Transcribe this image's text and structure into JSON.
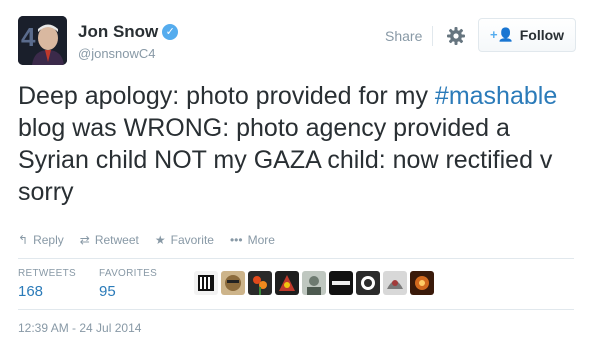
{
  "header": {
    "name": "Jon Snow",
    "username": "@jonsnowC4",
    "share_label": "Share",
    "follow_label": "Follow"
  },
  "tweet": {
    "text_before": "Deep apology: photo provided for my ",
    "hashtag": "#mashable",
    "text_after": " blog was WRONG: photo agency provided a Syrian child NOT my GAZA child: now rectified v sorry"
  },
  "actions": {
    "reply": "Reply",
    "retweet": "Retweet",
    "favorite": "Favorite",
    "more": "More"
  },
  "stats": {
    "retweets_label": "RETWEETS",
    "retweets_count": "168",
    "favorites_label": "FAVORITES",
    "favorites_count": "95"
  },
  "timestamp": "12:39 AM - 24 Jul 2014",
  "colors": {
    "link": "#2b7bb9",
    "verified": "#55acee",
    "muted": "#8899a6"
  }
}
